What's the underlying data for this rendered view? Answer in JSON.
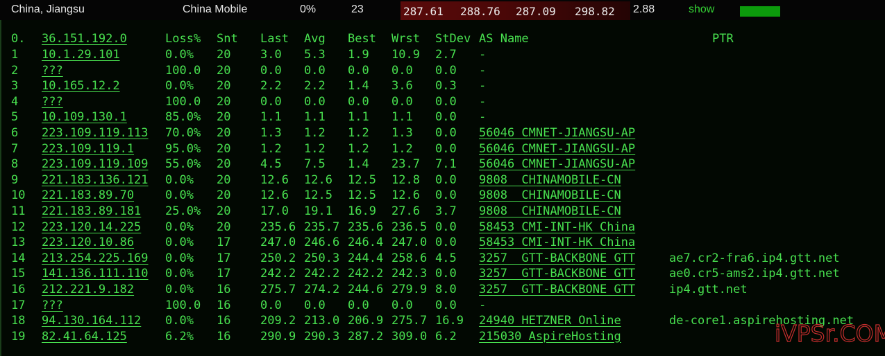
{
  "topbar": {
    "location": "China, Jiangsu",
    "isp": "China Mobile",
    "loss": "0%",
    "sent": "23",
    "latencies": [
      "287.61",
      "288.76",
      "287.09",
      "298.82"
    ],
    "stdev": "2.88",
    "show_label": "show",
    "colors": {
      "latency_bg": "#5a0b0b",
      "show": "#35d235",
      "bar": "#0c9a0c"
    }
  },
  "terminal": {
    "text_color": "#48e04f",
    "header": {
      "num": "0.",
      "host": "36.151.192.0",
      "loss": "Loss%",
      "snt": "Snt",
      "last": "Last",
      "avg": "Avg",
      "best": "Best",
      "wrst": "Wrst",
      "stdev": "StDev",
      "as_name": "AS Name",
      "ptr": "PTR"
    },
    "rows": [
      {
        "n": "1",
        "host": "10.1.29.101",
        "loss": "0.0%",
        "snt": "20",
        "last": "3.0",
        "avg": "5.3",
        "best": "1.9",
        "wrst": "10.9",
        "stdev": "2.7",
        "as": "-",
        "ptr": ""
      },
      {
        "n": "2",
        "host": "???",
        "loss": "100.0",
        "snt": "20",
        "last": "0.0",
        "avg": "0.0",
        "best": "0.0",
        "wrst": "0.0",
        "stdev": "0.0",
        "as": "-",
        "ptr": ""
      },
      {
        "n": "3",
        "host": "10.165.12.2",
        "loss": "0.0%",
        "snt": "20",
        "last": "2.2",
        "avg": "2.2",
        "best": "1.4",
        "wrst": "3.6",
        "stdev": "0.3",
        "as": "-",
        "ptr": ""
      },
      {
        "n": "4",
        "host": "???",
        "loss": "100.0",
        "snt": "20",
        "last": "0.0",
        "avg": "0.0",
        "best": "0.0",
        "wrst": "0.0",
        "stdev": "0.0",
        "as": "-",
        "ptr": ""
      },
      {
        "n": "5",
        "host": "10.109.130.1",
        "loss": "85.0%",
        "snt": "20",
        "last": "1.1",
        "avg": "1.1",
        "best": "1.1",
        "wrst": "1.1",
        "stdev": "0.0",
        "as": "-",
        "ptr": ""
      },
      {
        "n": "6",
        "host": "223.109.119.113",
        "loss": "70.0%",
        "snt": "20",
        "last": "1.3",
        "avg": "1.2",
        "best": "1.2",
        "wrst": "1.3",
        "stdev": "0.0",
        "as": "56046 CMNET-JIANGSU-AP",
        "ptr": ""
      },
      {
        "n": "7",
        "host": "223.109.119.1",
        "loss": "95.0%",
        "snt": "20",
        "last": "1.2",
        "avg": "1.2",
        "best": "1.2",
        "wrst": "1.2",
        "stdev": "0.0",
        "as": "56046 CMNET-JIANGSU-AP",
        "ptr": ""
      },
      {
        "n": "8",
        "host": "223.109.119.109",
        "loss": "55.0%",
        "snt": "20",
        "last": "4.5",
        "avg": "7.5",
        "best": "1.4",
        "wrst": "23.7",
        "stdev": "7.1",
        "as": "56046 CMNET-JIANGSU-AP",
        "ptr": ""
      },
      {
        "n": "9",
        "host": "221.183.136.121",
        "loss": "0.0%",
        "snt": "20",
        "last": "12.6",
        "avg": "12.6",
        "best": "12.5",
        "wrst": "12.8",
        "stdev": "0.0",
        "as": "9808  CHINAMOBILE-CN",
        "ptr": ""
      },
      {
        "n": "10",
        "host": "221.183.89.70",
        "loss": "0.0%",
        "snt": "20",
        "last": "12.6",
        "avg": "12.5",
        "best": "12.5",
        "wrst": "12.6",
        "stdev": "0.0",
        "as": "9808  CHINAMOBILE-CN",
        "ptr": ""
      },
      {
        "n": "11",
        "host": "221.183.89.181",
        "loss": "25.0%",
        "snt": "20",
        "last": "17.0",
        "avg": "19.1",
        "best": "16.9",
        "wrst": "27.6",
        "stdev": "3.7",
        "as": "9808  CHINAMOBILE-CN",
        "ptr": ""
      },
      {
        "n": "12",
        "host": "223.120.14.225",
        "loss": "0.0%",
        "snt": "20",
        "last": "235.6",
        "avg": "235.7",
        "best": "235.6",
        "wrst": "236.5",
        "stdev": "0.0",
        "as": "58453 CMI-INT-HK China",
        "ptr": ""
      },
      {
        "n": "13",
        "host": "223.120.10.86",
        "loss": "0.0%",
        "snt": "17",
        "last": "247.0",
        "avg": "246.6",
        "best": "246.4",
        "wrst": "247.0",
        "stdev": "0.0",
        "as": "58453 CMI-INT-HK China",
        "ptr": ""
      },
      {
        "n": "14",
        "host": "213.254.225.169",
        "loss": "0.0%",
        "snt": "17",
        "last": "250.2",
        "avg": "250.3",
        "best": "244.4",
        "wrst": "258.6",
        "stdev": "4.5",
        "as": "3257  GTT-BACKBONE GTT",
        "ptr": "ae7.cr2-fra6.ip4.gtt.net"
      },
      {
        "n": "15",
        "host": "141.136.111.110",
        "loss": "0.0%",
        "snt": "17",
        "last": "242.2",
        "avg": "242.2",
        "best": "242.2",
        "wrst": "242.3",
        "stdev": "0.0",
        "as": "3257  GTT-BACKBONE GTT",
        "ptr": "ae0.cr5-ams2.ip4.gtt.net"
      },
      {
        "n": "16",
        "host": "212.221.9.182",
        "loss": "0.0%",
        "snt": "16",
        "last": "275.7",
        "avg": "274.2",
        "best": "244.6",
        "wrst": "279.9",
        "stdev": "8.0",
        "as": "3257  GTT-BACKBONE GTT",
        "ptr": "ip4.gtt.net"
      },
      {
        "n": "17",
        "host": "???",
        "loss": "100.0",
        "snt": "16",
        "last": "0.0",
        "avg": "0.0",
        "best": "0.0",
        "wrst": "0.0",
        "stdev": "0.0",
        "as": "-",
        "ptr": ""
      },
      {
        "n": "18",
        "host": "94.130.164.112",
        "loss": "0.0%",
        "snt": "16",
        "last": "209.2",
        "avg": "213.0",
        "best": "206.9",
        "wrst": "275.7",
        "stdev": "16.9",
        "as": "24940 HETZNER Online",
        "ptr": "de-core1.aspirehosting.net"
      },
      {
        "n": "19",
        "host": "82.41.64.125",
        "loss": "6.2%",
        "snt": "16",
        "last": "290.9",
        "avg": "290.3",
        "best": "287.2",
        "wrst": "309.0",
        "stdev": "6.2",
        "as": "215030 AspireHosting",
        "ptr": ""
      }
    ]
  },
  "watermark": "iVPSr.COM"
}
